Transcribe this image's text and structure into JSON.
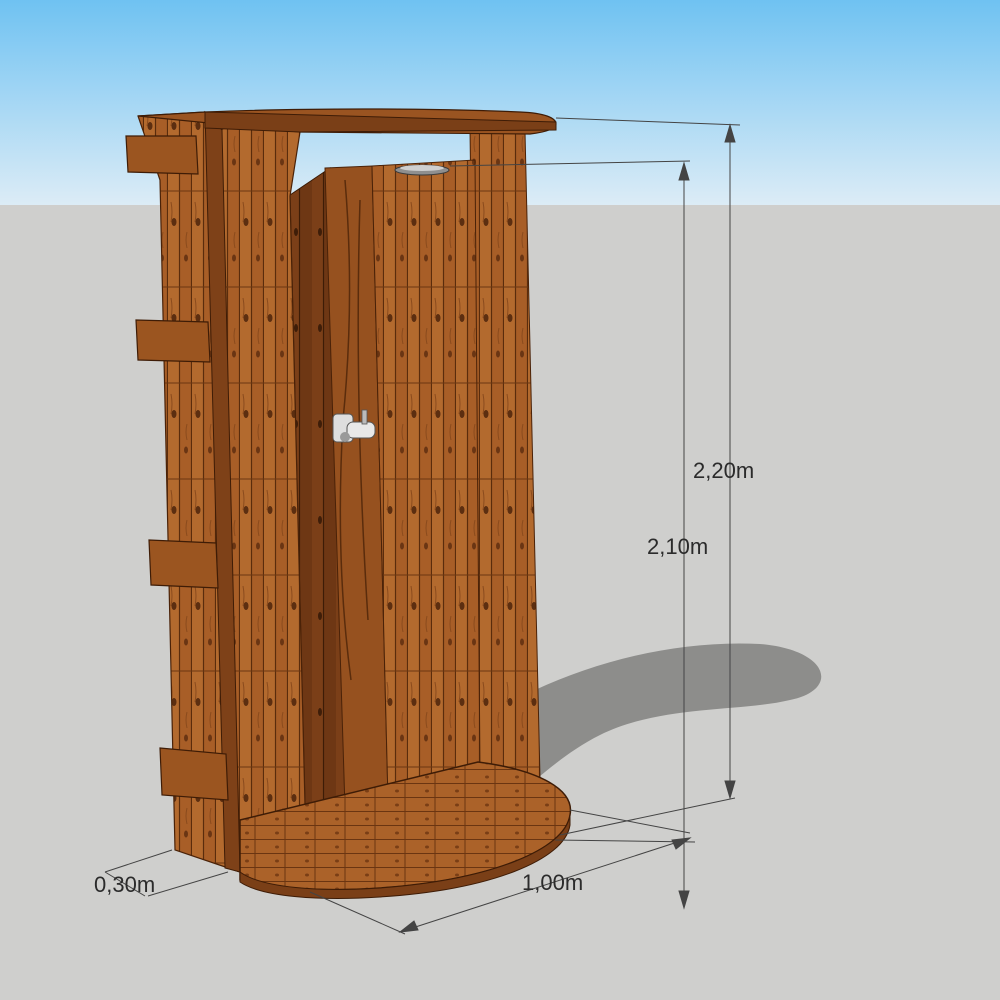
{
  "colors": {
    "sky_top": "#6fc2f2",
    "sky_bottom": "#dcecf6",
    "ground": "#cfcfcd",
    "shadow": "#8d8d8b",
    "wood_light": "#b56a2d",
    "wood_mid": "#96521f",
    "wood_dark": "#5c2f10",
    "dimension_line": "#444444"
  },
  "icons": {
    "faucet": "faucet-icon",
    "shower_head": "shower-head-icon"
  },
  "dimensions": {
    "total_height": "2,20m",
    "inner_height": "2,10m",
    "base_width": "1,00m",
    "base_depth": "0,30m"
  }
}
